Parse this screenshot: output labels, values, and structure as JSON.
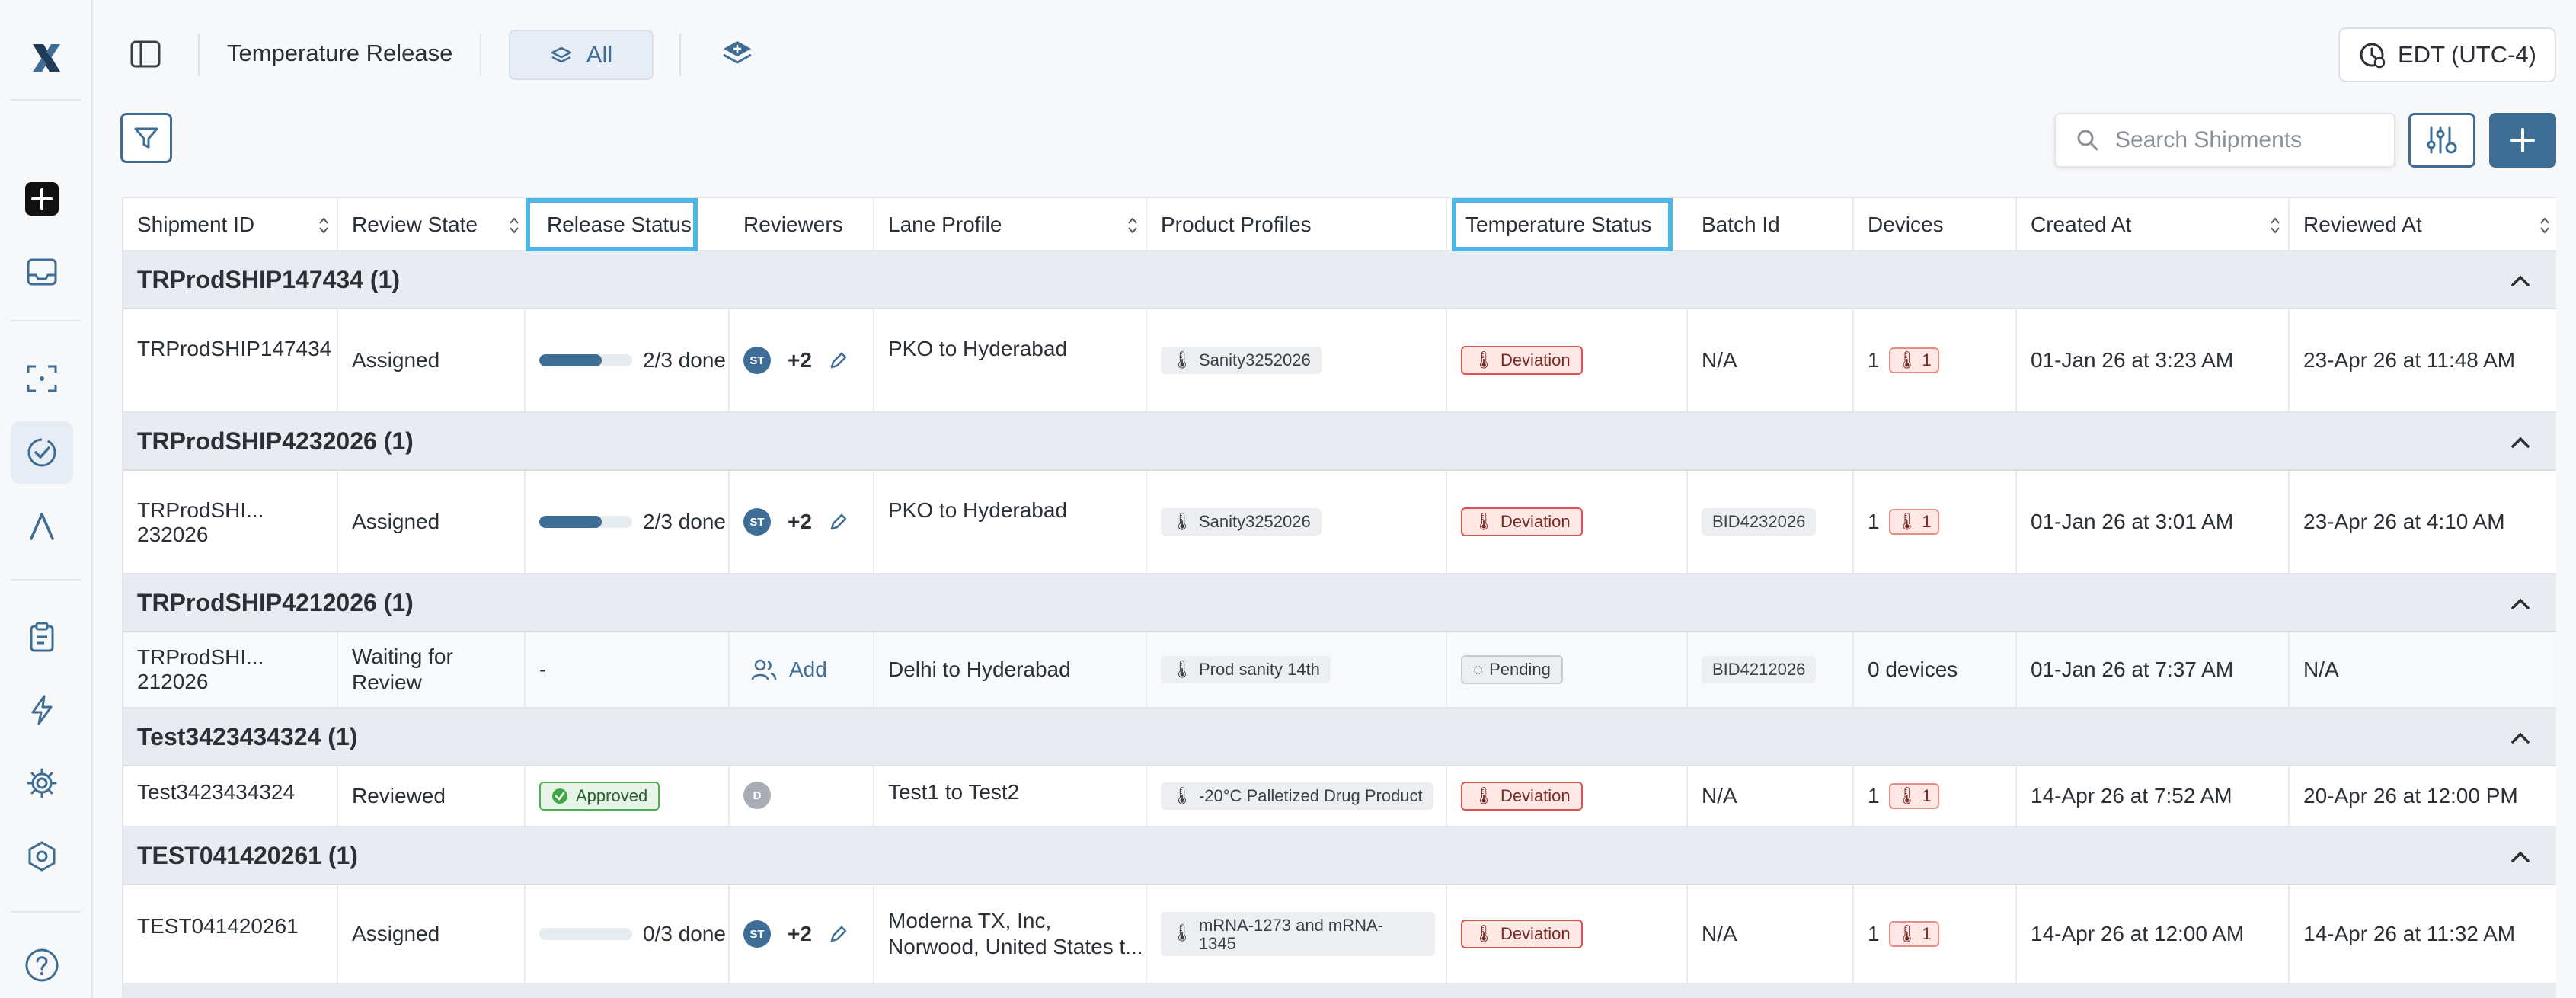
{
  "app": {
    "page_title": "Temperature Release",
    "view_selector": "All",
    "timezone": "EDT (UTC-4)"
  },
  "search": {
    "placeholder": "Search Shipments"
  },
  "nav": {
    "items": [
      "logo-icon",
      "create-icon",
      "inbox-icon",
      "scan-icon",
      "review-icon",
      "lane-icon",
      "clipboard-icon",
      "bolt-icon",
      "gear-icon",
      "shield-icon",
      "help-icon"
    ],
    "active": "review-icon"
  },
  "columns": [
    "Shipment ID",
    "Review State",
    "Release Status",
    "Reviewers",
    "Lane Profile",
    "Product Profiles",
    "Temperature Status",
    "Batch Id",
    "Devices",
    "Created At",
    "Reviewed At"
  ],
  "groups": [
    {
      "title": "TRProdSHIP147434 (1)",
      "row": {
        "shipment_id": "TRProdSHIP147434",
        "review_state": "Assigned",
        "release_progress": 0.67,
        "release_text": "2/3 done",
        "reviewer_initials": "ST",
        "reviewer_more": "+2",
        "lane": "PKO to Hyderabad",
        "product": "Sanity3252026",
        "temp_status": "Deviation",
        "batch": "N/A",
        "devices_count": "1",
        "devices_alerts": "1",
        "created_at": "01-Jan 26 at 3:23 AM",
        "reviewed_at": "23-Apr 26 at 11:48 AM"
      }
    },
    {
      "title": "TRProdSHIP4232026 (1)",
      "row": {
        "shipment_id": "TRProdSHI... 232026",
        "review_state": "Assigned",
        "release_progress": 0.67,
        "release_text": "2/3 done",
        "reviewer_initials": "ST",
        "reviewer_more": "+2",
        "lane": "PKO to Hyderabad",
        "product": "Sanity3252026",
        "temp_status": "Deviation",
        "batch": "BID4232026",
        "devices_count": "1",
        "devices_alerts": "1",
        "created_at": "01-Jan 26 at 3:01 AM",
        "reviewed_at": "23-Apr 26 at 4:10 AM"
      }
    },
    {
      "title": "TRProdSHIP4212026 (1)",
      "row": {
        "shipment_id": "TRProdSHI... 212026",
        "review_state": "Waiting for Review",
        "release_text": "-",
        "add_label": "Add",
        "lane": "Delhi to Hyderabad",
        "product": "Prod sanity 14th",
        "temp_status": "Pending",
        "batch": "BID4212026",
        "devices_text": "0 devices",
        "created_at": "01-Jan 26 at 7:37 AM",
        "reviewed_at": "N/A"
      }
    },
    {
      "title": "Test3423434324 (1)",
      "row": {
        "shipment_id": "Test3423434324",
        "review_state": "Reviewed",
        "release_badge": "Approved",
        "reviewer_initials": "D",
        "lane": "Test1 to Test2",
        "product": "-20°C Palletized Drug Product",
        "temp_status": "Deviation",
        "batch": "N/A",
        "devices_count": "1",
        "devices_alerts": "1",
        "created_at": "14-Apr 26 at 7:52 AM",
        "reviewed_at": "20-Apr 26 at 12:00 PM"
      }
    },
    {
      "title": "TEST041420261 (1)",
      "row": {
        "shipment_id": "TEST041420261",
        "review_state": "Assigned",
        "release_progress": 0.0,
        "release_text": "0/3 done",
        "reviewer_initials": "ST",
        "reviewer_more": "+2",
        "lane_line1": "Moderna TX, Inc,",
        "lane_line2": "Norwood, United States t...",
        "product_line1": "mRNA-1273 and mRNA-",
        "product_line2": "1345",
        "temp_status": "Deviation",
        "batch": "N/A",
        "devices_count": "1",
        "devices_alerts": "1",
        "created_at": "14-Apr 26 at 12:00 AM",
        "reviewed_at": "14-Apr 26 at 11:32 AM"
      }
    }
  ],
  "colors": {
    "accent": "#3e6d96",
    "highlight": "#4db6e8",
    "deviation": "#d9534f",
    "approved": "#4caf50",
    "group_bg": "#e8ebef"
  }
}
